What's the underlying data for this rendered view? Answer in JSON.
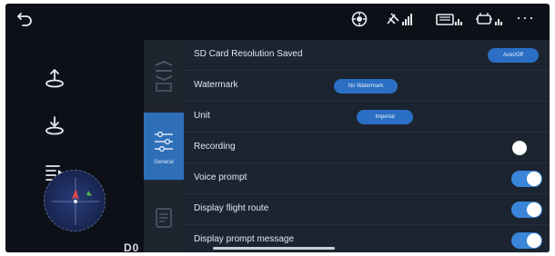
{
  "colors": {
    "background": "#0d1017",
    "panel": "#1b2430",
    "accent": "#2a6fc4",
    "toggle_on": "#3b86d8"
  },
  "status_bar": {
    "icons": [
      "back-arrow-icon",
      "drone-camera-icon",
      "satellite-signal-icon",
      "aircraft-battery-icon",
      "remote-controller-signal-icon",
      "more-dots-icon"
    ],
    "more_label": "···"
  },
  "left_panel": {
    "buttons": [
      "takeoff-icon",
      "landing-icon",
      "flight-log-icon"
    ],
    "label": "D0"
  },
  "settings": {
    "tabs": [
      "camera-settings-tab",
      "general-settings-tab",
      "about-tab"
    ],
    "active_tab_label": "General",
    "rows": [
      {
        "label": "SD Card Resolution Saved",
        "options": [
          "",
          "Auto/Off"
        ],
        "selected": 1
      },
      {
        "label": "Watermark",
        "options": [
          "No Watermark",
          "",
          ""
        ],
        "selected": 0
      },
      {
        "label": "Unit",
        "options": [
          "Imperial",
          "",
          ""
        ],
        "selected": 0
      },
      {
        "label": "Recording",
        "toggle": false
      },
      {
        "label": "Voice prompt",
        "toggle": true
      },
      {
        "label": "Display flight route",
        "toggle": true
      },
      {
        "label": "Display prompt message",
        "toggle": true
      }
    ]
  }
}
